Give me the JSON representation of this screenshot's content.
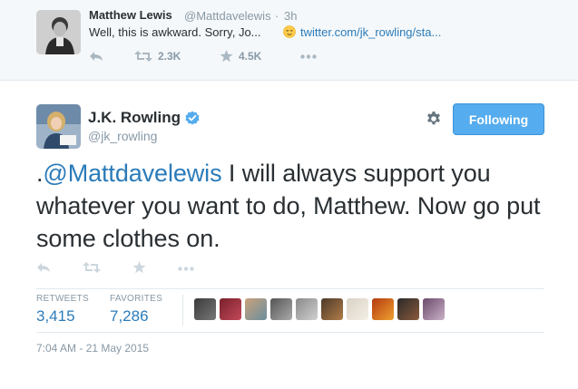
{
  "top_tweet": {
    "name": "Matthew Lewis",
    "handle": "@Mattdavelewis",
    "dot": "·",
    "time": "3h",
    "text": "Well, this is awkward. Sorry, Jo...",
    "emoji_icon": "relieved-face-emoji",
    "link": "twitter.com/jk_rowling/sta...",
    "retweets": "2.3K",
    "favorites": "4.5K"
  },
  "main_tweet": {
    "name": "J.K. Rowling",
    "handle": "@jk_rowling",
    "follow_label": "Following",
    "text_prefix": ".",
    "mention": "@Mattdavelewis",
    "text_body": " I will always support you whatever you want to do, Matthew.  Now go put some clothes on.",
    "retweets_label": "RETWEETS",
    "retweets_value": "3,415",
    "favorites_label": "FAVORITES",
    "favorites_value": "7,286",
    "timestamp": "7:04 AM - 21 May 2015"
  },
  "colors": {
    "link": "#2b7bb9",
    "follow_button": "#55acee",
    "muted": "#8899a6",
    "verified": "#55acee"
  }
}
